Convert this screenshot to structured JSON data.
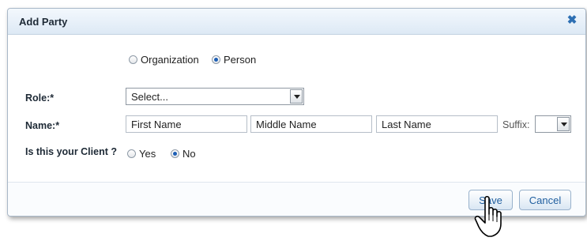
{
  "dialog": {
    "title": "Add Party",
    "close_icon": "close-icon",
    "party_type": {
      "options": [
        "Organization",
        "Person"
      ],
      "selected": "Person"
    },
    "role": {
      "label": "Role:*",
      "value": "Select..."
    },
    "name": {
      "label": "Name:*",
      "first_placeholder": "First Name",
      "middle_placeholder": "Middle Name",
      "last_placeholder": "Last Name",
      "suffix_label": "Suffix:",
      "suffix_value": ""
    },
    "client": {
      "label": "Is this your Client ?",
      "options": [
        "Yes",
        "No"
      ],
      "selected": "No"
    },
    "buttons": {
      "save": "Save",
      "cancel": "Cancel"
    }
  },
  "colors": {
    "accent": "#2d6fb3",
    "button_text": "#1f5e9f",
    "title_bar": "#dde9f5"
  },
  "cursor": "pointer-hand-icon"
}
